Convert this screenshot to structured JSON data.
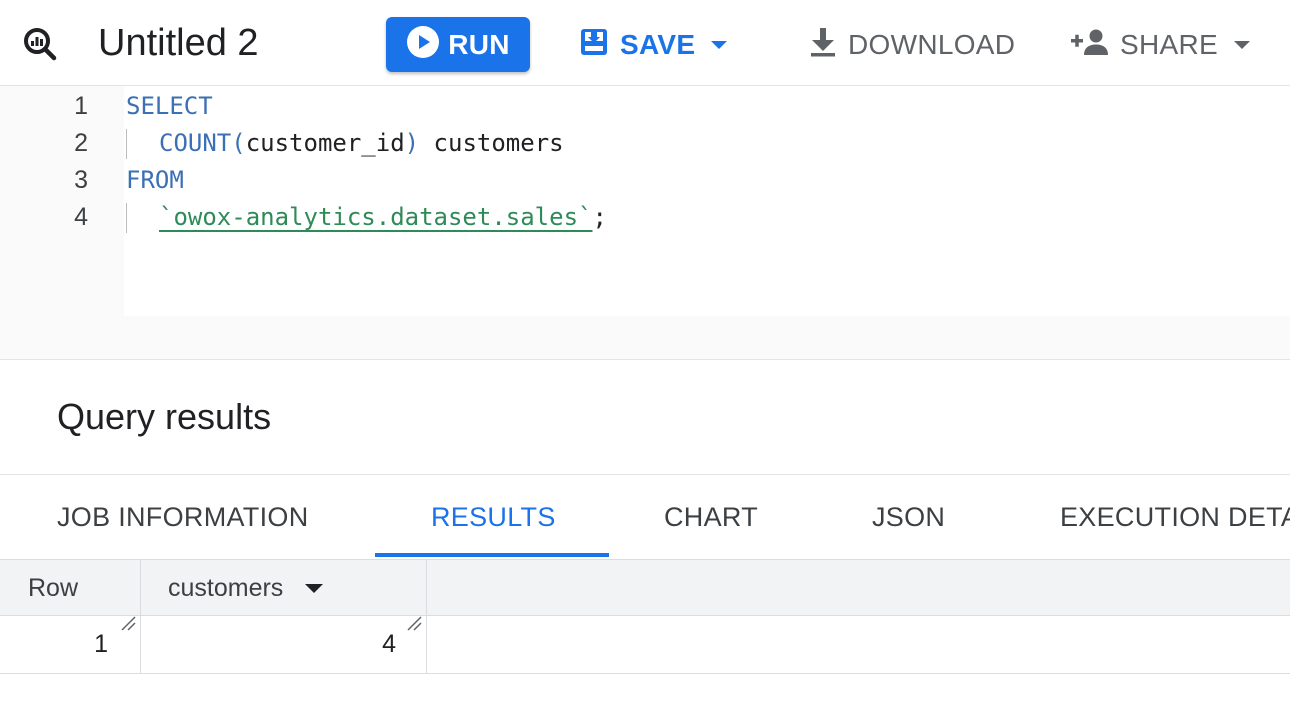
{
  "toolbar": {
    "title": "Untitled 2",
    "run_label": "RUN",
    "save_label": "SAVE",
    "download_label": "DOWNLOAD",
    "share_label": "SHARE",
    "accent_color": "#1a73e8"
  },
  "editor": {
    "line_numbers": [
      "1",
      "2",
      "3",
      "4"
    ],
    "lines": {
      "l1_keyword": "SELECT",
      "l2_function": "COUNT",
      "l2_open_paren": "(",
      "l2_argument": "customer_id",
      "l2_close_paren": ")",
      "l2_alias": " customers",
      "l3_keyword": "FROM",
      "l4_table": "`owox-analytics.dataset.sales`",
      "l4_terminator": ";"
    }
  },
  "results": {
    "title": "Query results",
    "tabs": [
      {
        "label": "JOB INFORMATION",
        "active": false
      },
      {
        "label": "RESULTS",
        "active": true
      },
      {
        "label": "CHART",
        "active": false
      },
      {
        "label": "JSON",
        "active": false
      },
      {
        "label": "EXECUTION DETAILS",
        "active": false
      }
    ],
    "table": {
      "columns": [
        "Row",
        "customers"
      ],
      "rows": [
        {
          "row": "1",
          "customers": "4"
        }
      ]
    }
  },
  "icons": {
    "app": "query-magnifier-icon",
    "run": "play-circle-icon",
    "save": "save-icon",
    "download": "download-icon",
    "share": "person-add-icon"
  }
}
